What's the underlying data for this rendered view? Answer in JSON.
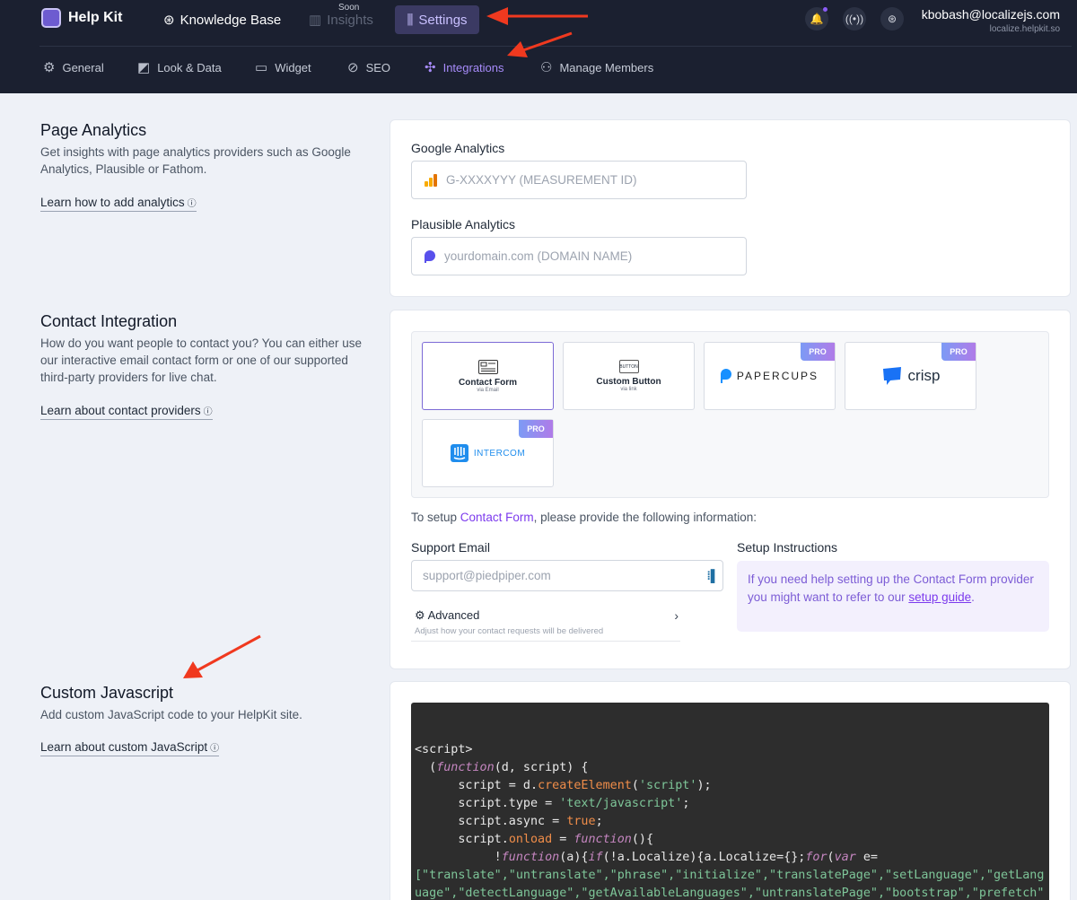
{
  "header": {
    "brand": "Help Kit",
    "nav": {
      "knowledge_base": "Knowledge Base",
      "insights": "Insights",
      "insights_badge": "Soon",
      "settings": "Settings"
    },
    "user_email": "kbobash@localizejs.com",
    "user_site": "localize.helpkit.so"
  },
  "subnav": [
    {
      "label": "General",
      "icon": "gear-icon"
    },
    {
      "label": "Look & Data",
      "icon": "palette-icon"
    },
    {
      "label": "Widget",
      "icon": "widget-icon"
    },
    {
      "label": "SEO",
      "icon": "search-icon"
    },
    {
      "label": "Integrations",
      "icon": "puzzle-icon",
      "active": true
    },
    {
      "label": "Manage Members",
      "icon": "users-icon"
    }
  ],
  "analytics": {
    "title": "Page Analytics",
    "description": "Get insights with page analytics providers such as Google Analytics, Plausible or Fathom.",
    "learn_link": "Learn how to add analytics",
    "google_label": "Google Analytics",
    "google_placeholder": "G-XXXXYYY (MEASUREMENT ID)",
    "plausible_label": "Plausible Analytics",
    "plausible_placeholder": "yourdomain.com (DOMAIN NAME)"
  },
  "contact": {
    "title": "Contact Integration",
    "description": "How do you want people to contact you? You can either use our interactive email contact form or one of our supported third-party providers for live chat.",
    "learn_link": "Learn about contact providers",
    "providers": {
      "contact_form": {
        "title": "Contact Form",
        "sub": "via Email"
      },
      "custom_button": {
        "title": "Custom Button",
        "sub": "via link",
        "mini": "BUTTON"
      },
      "papercups": {
        "name": "PAPERCUPS",
        "badge": "PRO"
      },
      "crisp": {
        "name": "crisp",
        "badge": "PRO"
      },
      "intercom": {
        "name": "INTERCOM",
        "badge": "PRO"
      }
    },
    "setup_prefix": "To setup ",
    "setup_link": "Contact Form",
    "setup_suffix": ", please provide the following information:",
    "support_email_label": "Support Email",
    "support_email_placeholder": "support@piedpiper.com",
    "advanced_title": "Advanced",
    "advanced_sub": "Adjust how your contact requests will be delivered",
    "instructions_label": "Setup Instructions",
    "instructions_text": "If you need help setting up the Contact Form provider you might want to refer to our ",
    "instructions_link": "setup guide",
    "instructions_end": "."
  },
  "custom_js": {
    "title": "Custom Javascript",
    "description": "Add custom JavaScript code to your HelpKit site.",
    "learn_link": "Learn about custom JavaScript",
    "code": {
      "l1": "<script>",
      "l2_fn": "function",
      "l2_rest": "(d, script) {",
      "l3_a": "      script = d.",
      "l3_fn": "createElement",
      "l3_b": "(",
      "l3_s": "'script'",
      "l3_c": ");",
      "l4_a": "      script.type = ",
      "l4_s": "'text/javascript'",
      "l4_c": ";",
      "l5_a": "      script.async = ",
      "l5_v": "true",
      "l5_c": ";",
      "l6_a": "      script.",
      "l6_p": "onload",
      "l6_b": " = ",
      "l6_fn": "function",
      "l6_c": "(){",
      "l7_a": "           !",
      "l7_fn": "function",
      "l7_b": "(a){",
      "l7_if": "if",
      "l7_c": "(!a.Localize){a.Localize={};",
      "l7_for": "for",
      "l7_d": "(",
      "l7_var": "var",
      "l7_e": " e=",
      "l8": "[\"translate\",\"untranslate\",\"phrase\",\"initialize\",\"translatePage\",\"setLanguage\",\"getLang",
      "l9": "uage\",\"detectLanguage\",\"getAvailableLanguages\",\"untranslatePage\",\"bootstrap\",\"prefetch\""
    }
  },
  "colors": {
    "accent": "#7c3aed",
    "topbar": "#1b2030",
    "background": "#eef1f7"
  }
}
